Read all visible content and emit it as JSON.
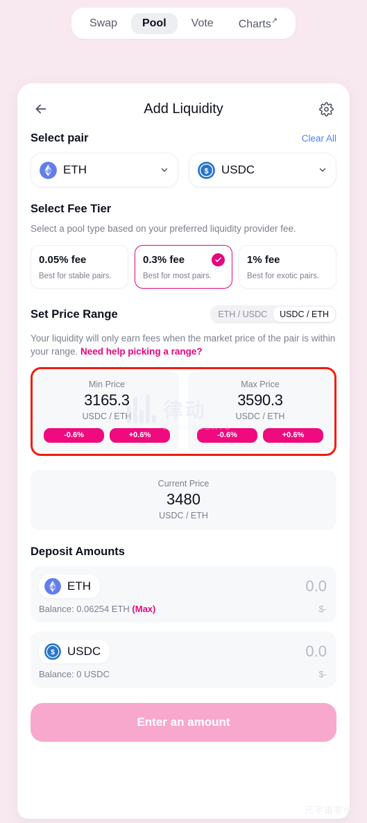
{
  "nav": {
    "items": [
      {
        "label": "Swap",
        "active": false,
        "external": false
      },
      {
        "label": "Pool",
        "active": true,
        "external": false
      },
      {
        "label": "Vote",
        "active": false,
        "external": false
      },
      {
        "label": "Charts",
        "active": false,
        "external": true
      }
    ],
    "external_glyph": "↗"
  },
  "header": {
    "title": "Add Liquidity",
    "back_icon": "arrow-left-icon",
    "settings_icon": "gear-icon"
  },
  "select_pair": {
    "title": "Select pair",
    "clear_all": "Clear All",
    "tokens": [
      {
        "symbol": "ETH",
        "icon": "ethereum-icon",
        "color": "#627eea"
      },
      {
        "symbol": "USDC",
        "icon": "usdc-icon",
        "color": "#2775ca"
      }
    ],
    "chevron": "⌄"
  },
  "fee_tier": {
    "title": "Select Fee Tier",
    "subtitle": "Select a pool type based on your preferred liquidity provider fee.",
    "options": [
      {
        "amount": "0.05% fee",
        "desc": "Best for stable pairs.",
        "selected": false
      },
      {
        "amount": "0.3% fee",
        "desc": "Best for most pairs.",
        "selected": true
      },
      {
        "amount": "1% fee",
        "desc": "Best for exotic pairs.",
        "selected": false
      }
    ],
    "selected_color": "#e5057f"
  },
  "price_range": {
    "title": "Set Price Range",
    "toggle": [
      {
        "label": "ETH / USDC",
        "active": false
      },
      {
        "label": "USDC / ETH",
        "active": true
      }
    ],
    "note": "Your liquidity will only earn fees when the market price of the pair is within your range. ",
    "note_link": "Need help picking a range?",
    "highlight_color": "#f41b0d",
    "min": {
      "label": "Min Price",
      "value": "3165.3",
      "pair": "USDC / ETH",
      "dec_label": "-0.6%",
      "inc_label": "+0.6%"
    },
    "max": {
      "label": "Max Price",
      "value": "3590.3",
      "pair": "USDC / ETH",
      "dec_label": "-0.6%",
      "inc_label": "+0.6%"
    },
    "current": {
      "label": "Current Price",
      "value": "3480",
      "pair": "USDC / ETH"
    }
  },
  "deposit": {
    "title": "Deposit Amounts",
    "rows": [
      {
        "symbol": "ETH",
        "icon": "ethereum-icon",
        "amount": "0.0",
        "balance": "Balance: 0.06254 ETH ",
        "max_label": "(Max)",
        "has_max": true,
        "usd": "$-"
      },
      {
        "symbol": "USDC",
        "icon": "usdc-icon",
        "amount": "0.0",
        "balance": "Balance: 0 USDC",
        "max_label": "",
        "has_max": false,
        "usd": "$-"
      }
    ]
  },
  "cta": {
    "label": "Enter an amount"
  },
  "watermark": {
    "cn": "律动",
    "en": "BLOCKBEATS",
    "corner": "元宇宙非小号"
  }
}
